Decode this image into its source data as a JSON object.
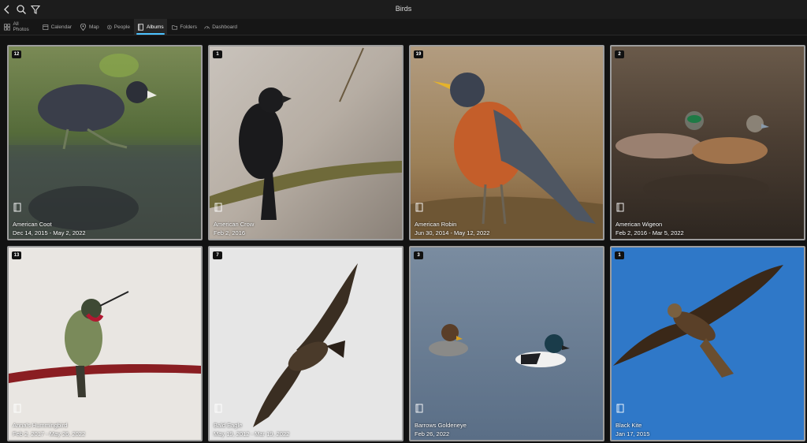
{
  "window": {
    "title": "Birds"
  },
  "toolbar": {
    "back_icon": "back-arrow-icon",
    "search_icon": "search-icon",
    "filter_icon": "filter-icon"
  },
  "tabs": [
    {
      "label": "All Photos",
      "icon": "photos-icon",
      "active": false
    },
    {
      "label": "Calendar",
      "icon": "calendar-icon",
      "active": false
    },
    {
      "label": "Map",
      "icon": "map-pin-icon",
      "active": false
    },
    {
      "label": "People",
      "icon": "people-icon",
      "active": false
    },
    {
      "label": "Albums",
      "icon": "album-icon",
      "active": true
    },
    {
      "label": "Folders",
      "icon": "folder-icon",
      "active": false
    },
    {
      "label": "Dashboard",
      "icon": "dashboard-icon",
      "active": false
    }
  ],
  "accent_color": "#4cc2ff",
  "albums": [
    {
      "count": "12",
      "name": "American Coot",
      "dates": "Dec 14, 2015 - May 2, 2022"
    },
    {
      "count": "1",
      "name": "American Crow",
      "dates": "Feb 2, 2016"
    },
    {
      "count": "19",
      "name": "American Robin",
      "dates": "Jun 30, 2014 - May 12, 2022"
    },
    {
      "count": "2",
      "name": "American Wigeon",
      "dates": "Feb 2, 2016 - Mar 5, 2022"
    },
    {
      "count": "13",
      "name": "Anna's Hummingbird",
      "dates": "Feb 2, 2017 - May 26, 2022"
    },
    {
      "count": "7",
      "name": "Bald Eagle",
      "dates": "May 19, 2012 - Mar 19, 2022"
    },
    {
      "count": "3",
      "name": "Barrows Goldeneye",
      "dates": "Feb 26, 2022"
    },
    {
      "count": "1",
      "name": "Black Kite",
      "dates": "Jan 17, 2015"
    }
  ]
}
